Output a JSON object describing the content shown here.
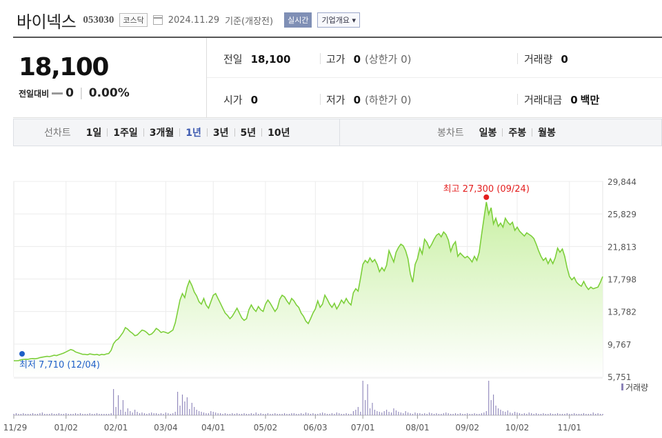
{
  "header": {
    "name": "바이넥스",
    "code": "053030",
    "market": "코스닥",
    "date": "2024.11.29",
    "date_suffix": "기준(개장전)",
    "live": "실시간",
    "corp": "기업개요 ▾"
  },
  "quote": {
    "price": "18,100",
    "diff_label": "전일대비",
    "diff_value": "0",
    "diff_pct": "0.00%",
    "cells": [
      {
        "k": "전일",
        "v": "18,100",
        "sub": ""
      },
      {
        "k": "고가",
        "v": "0",
        "sub": "(상한가 0)"
      },
      {
        "k": "거래량",
        "v": "0",
        "sub": ""
      },
      {
        "k": "시가",
        "v": "0",
        "sub": ""
      },
      {
        "k": "저가",
        "v": "0",
        "sub": "(하한가 0)"
      },
      {
        "k": "거래대금",
        "v": "0",
        "sub": "백만"
      }
    ]
  },
  "tabs": {
    "line_label": "선차트",
    "line_items": [
      "1일",
      "1주일",
      "3개월",
      "1년",
      "3년",
      "5년",
      "10년"
    ],
    "active": "1년",
    "candle_label": "봉차트",
    "candle_items": [
      "일봉",
      "주봉",
      "월봉"
    ]
  },
  "colors": {
    "line": "#7ccf3a",
    "fill_top": "#c9f0a4",
    "max": "#e41e1e",
    "min": "#1e5fc8",
    "volume": "#8b82b8"
  },
  "chart_data": {
    "type": "area",
    "y_ticks": [
      29844,
      25829,
      21813,
      17798,
      13782,
      9767,
      5751
    ],
    "y_tick_labels": [
      "29,844",
      "25,829",
      "21,813",
      "17,798",
      "13,782",
      "9,767",
      "5,751"
    ],
    "ylim": [
      5751,
      29844
    ],
    "x_tick_labels": [
      "11/29",
      "01/02",
      "02/01",
      "03/04",
      "04/01",
      "05/02",
      "06/03",
      "07/01",
      "08/01",
      "09/02",
      "10/02",
      "11/01"
    ],
    "max_annotation": "최고 27,300 (09/24)",
    "min_annotation": "최저 7,710 (12/04)",
    "volume_label": "거래량",
    "series": [
      {
        "values": [
          7720,
          7710,
          7730,
          7820,
          7880,
          7900,
          7890,
          7950,
          7980,
          7960,
          8000,
          8100,
          8150,
          8200,
          8250,
          8220,
          8300,
          8400,
          8350,
          8450,
          8550,
          8650,
          8800,
          8950,
          9100,
          9000,
          8800,
          8700,
          8600,
          8500,
          8500,
          8450,
          8550,
          8500,
          8450,
          8500,
          8400,
          8500,
          8450,
          8550,
          8600,
          9000,
          9800,
          10200,
          10400,
          10800,
          11200,
          11800,
          11600,
          11300,
          11100,
          10800,
          10900,
          11200,
          11500,
          11400,
          11200,
          10900,
          11000,
          11300,
          11700,
          11500,
          11200,
          11300,
          11200,
          11100,
          11300,
          11500,
          12400,
          13800,
          15200,
          16000,
          15500,
          16800,
          17600,
          17000,
          16200,
          15700,
          15000,
          14700,
          15400,
          14600,
          14200,
          15000,
          15800,
          16000,
          15400,
          14800,
          14200,
          13600,
          13300,
          12900,
          13200,
          13700,
          14200,
          13600,
          13000,
          12700,
          12900,
          14000,
          14600,
          14100,
          13800,
          14400,
          14000,
          13800,
          14700,
          15200,
          14800,
          14300,
          13800,
          14200,
          15300,
          15800,
          15600,
          15100,
          14700,
          15400,
          15100,
          14600,
          14300,
          13600,
          13200,
          12600,
          12300,
          12900,
          13600,
          14100,
          15100,
          14300,
          14700,
          15800,
          15300,
          14700,
          14300,
          14800,
          14100,
          14600,
          15200,
          14800,
          15400,
          14900,
          14600,
          16100,
          16600,
          16300,
          17900,
          19600,
          20100,
          19800,
          20400,
          19900,
          20200,
          19600,
          18700,
          19200,
          18800,
          19500,
          21300,
          20600,
          19900,
          21100,
          21700,
          22100,
          21900,
          21300,
          20300,
          18400,
          17400,
          19600,
          20300,
          21600,
          20900,
          22700,
          22300,
          21600,
          22100,
          22700,
          23200,
          23400,
          23000,
          23600,
          23300,
          22600,
          21200,
          22000,
          22400,
          20600,
          21000,
          20700,
          20400,
          20600,
          20300,
          19900,
          20600,
          20100,
          21100,
          23300,
          25300,
          27300,
          25800,
          26600,
          24600,
          25300,
          24300,
          24700,
          24200,
          25300,
          24800,
          24500,
          24800,
          23800,
          24200,
          23700,
          23400,
          23100,
          23500,
          23300,
          23100,
          22800,
          22100,
          21300,
          20600,
          20100,
          20400,
          19700,
          20300,
          19700,
          20400,
          21600,
          21100,
          21500,
          20600,
          19200,
          18100,
          17700,
          18000,
          17400,
          17100,
          16900,
          17500,
          16900,
          16500,
          16800,
          16600,
          16700,
          16800,
          17400,
          18100
        ]
      }
    ]
  }
}
